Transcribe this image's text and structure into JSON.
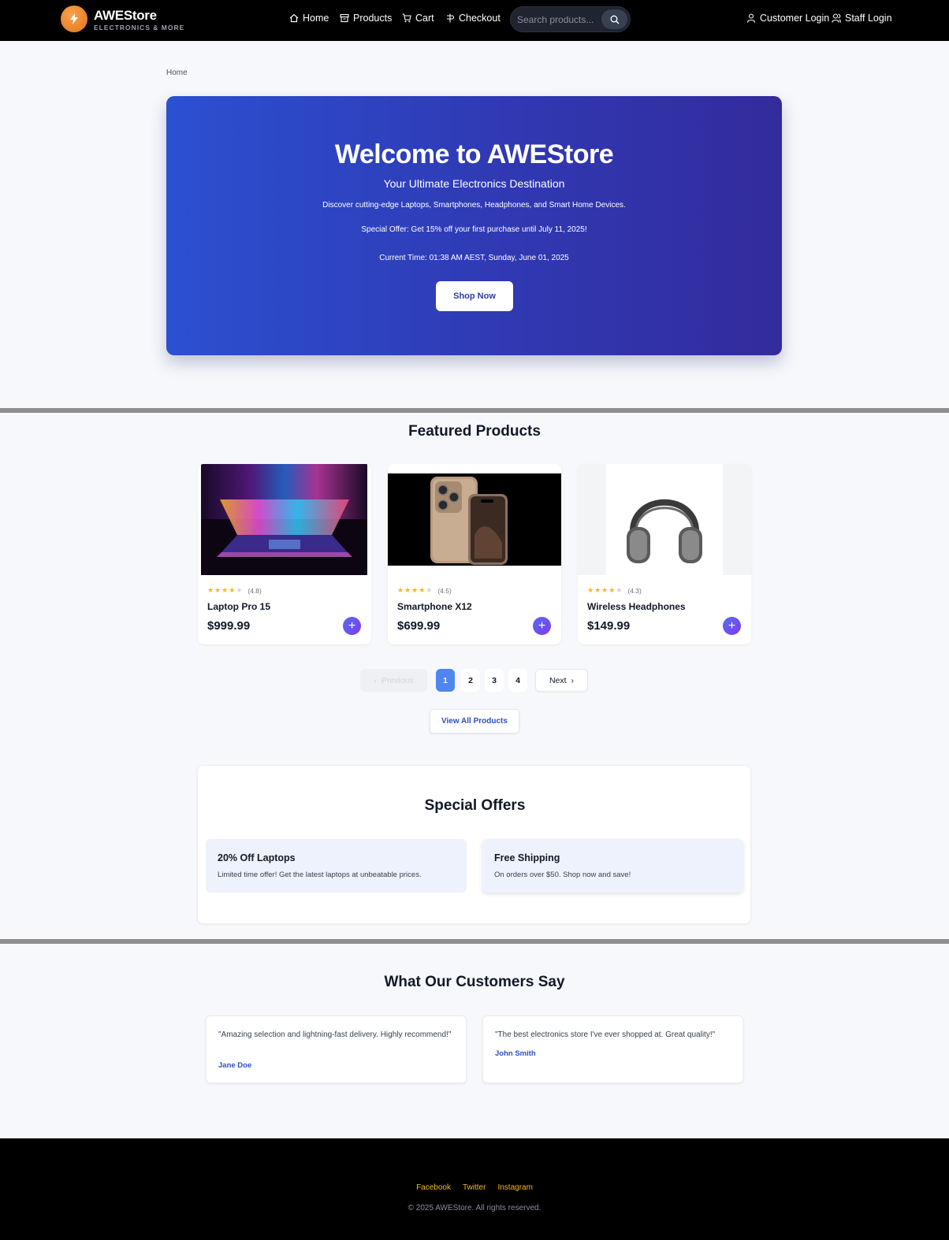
{
  "header": {
    "brand_name": "AWEStore",
    "brand_tagline": "ELECTRONICS & MORE",
    "nav": [
      {
        "label": "Home",
        "icon": "home-icon"
      },
      {
        "label": "Products",
        "icon": "box-icon"
      },
      {
        "label": "Cart",
        "icon": "cart-icon"
      },
      {
        "label": "Checkout",
        "icon": "checkout-icon"
      }
    ],
    "search_placeholder": "Search products...",
    "customer_login": "Customer Login",
    "staff_login": "Staff Login"
  },
  "breadcrumb": "Home",
  "hero": {
    "title": "Welcome to AWEStore",
    "subtitle": "Your Ultimate Electronics Destination",
    "description": "Discover cutting-edge Laptops, Smartphones, Headphones, and Smart Home Devices.",
    "offer": "Special Offer: Get 15% off your first purchase until July 11, 2025!",
    "current_time": "Current Time: 01:38 AM AEST, Sunday, June 01, 2025",
    "cta": "Shop Now"
  },
  "featured": {
    "title": "Featured Products",
    "products": [
      {
        "name": "Laptop Pro 15",
        "price": "$999.99",
        "rating": "(4.8)",
        "stars": 4
      },
      {
        "name": "Smartphone X12",
        "price": "$699.99",
        "rating": "(4.5)",
        "stars": 4
      },
      {
        "name": "Wireless Headphones",
        "price": "$149.99",
        "rating": "(4.3)",
        "stars": 4
      }
    ],
    "pagination": {
      "previous": "Previous",
      "pages": [
        "1",
        "2",
        "3",
        "4"
      ],
      "current": "1",
      "next": "Next"
    },
    "view_all": "View All Products"
  },
  "offers": {
    "title": "Special Offers",
    "items": [
      {
        "title": "20% Off Laptops",
        "description": "Limited time offer! Get the latest laptops at unbeatable prices."
      },
      {
        "title": "Free Shipping",
        "description": "On orders over $50. Shop now and save!"
      }
    ]
  },
  "testimonials": {
    "title": "What Our Customers Say",
    "items": [
      {
        "quote": "\"Amazing selection and lightning-fast delivery. Highly recommend!\"",
        "author": "Jane Doe"
      },
      {
        "quote": "\"The best electronics store I've ever shopped at. Great quality!\"",
        "author": "John Smith"
      }
    ]
  },
  "footer": {
    "links": [
      "Facebook",
      "Twitter",
      "Instagram"
    ],
    "copyright": "© 2025 AWEStore. All rights reserved."
  },
  "colors": {
    "accent": "#2b4fc7",
    "star": "#f5b819",
    "pagination_active": "#4f86f0",
    "footer_link": "#f5b819"
  }
}
